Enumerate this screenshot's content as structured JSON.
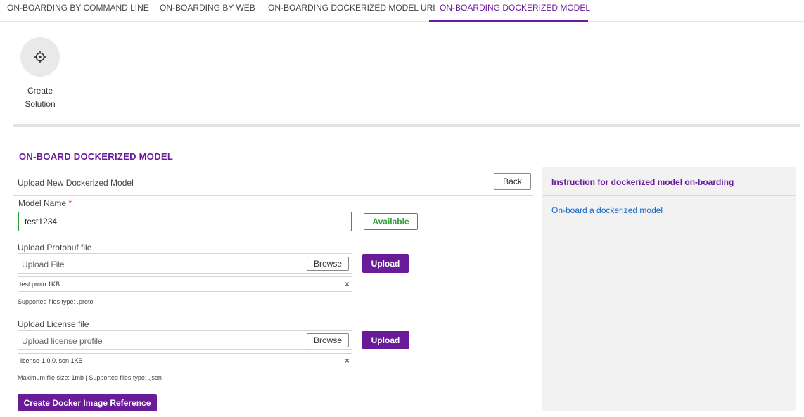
{
  "tabs": [
    {
      "label": "ON-BOARDING BY COMMAND LINE",
      "active": false
    },
    {
      "label": "ON-BOARDING BY WEB",
      "active": false
    },
    {
      "label": "ON-BOARDING DOCKERIZED MODEL URI",
      "active": false
    },
    {
      "label": "ON-BOARDING DOCKERIZED MODEL",
      "active": true
    }
  ],
  "step": {
    "icon": "crosshair-icon",
    "label_line1": "Create",
    "label_line2": "Solution"
  },
  "section": {
    "title": "ON-BOARD DOCKERIZED MODEL"
  },
  "form": {
    "title": "Upload New Dockerized Model",
    "back_label": "Back",
    "model_name_label": "Model Name",
    "required_mark": "*",
    "model_name_value": "test1234",
    "available_label": "Available",
    "protobuf": {
      "label": "Upload Protobuf file",
      "placeholder": "Upload File",
      "browse_label": "Browse",
      "upload_label": "Upload",
      "file": "test.proto 1KB",
      "hint": "Supported files type: .proto"
    },
    "license": {
      "label": "Upload License file",
      "placeholder": "Upload license profile",
      "browse_label": "Browse",
      "upload_label": "Upload",
      "file": "license-1.0.0.json 1KB",
      "hint": "Maximum file size: 1mb | Supported files type: .json"
    },
    "remove_symbol": "×",
    "create_label": "Create Docker Image Reference"
  },
  "instructions": {
    "title": "Instruction for dockerized model on-boarding",
    "link": "On-board a dockerized model"
  },
  "colors": {
    "accent": "#6a1b9a",
    "success": "#2e9e3a",
    "link": "#1565c0"
  }
}
